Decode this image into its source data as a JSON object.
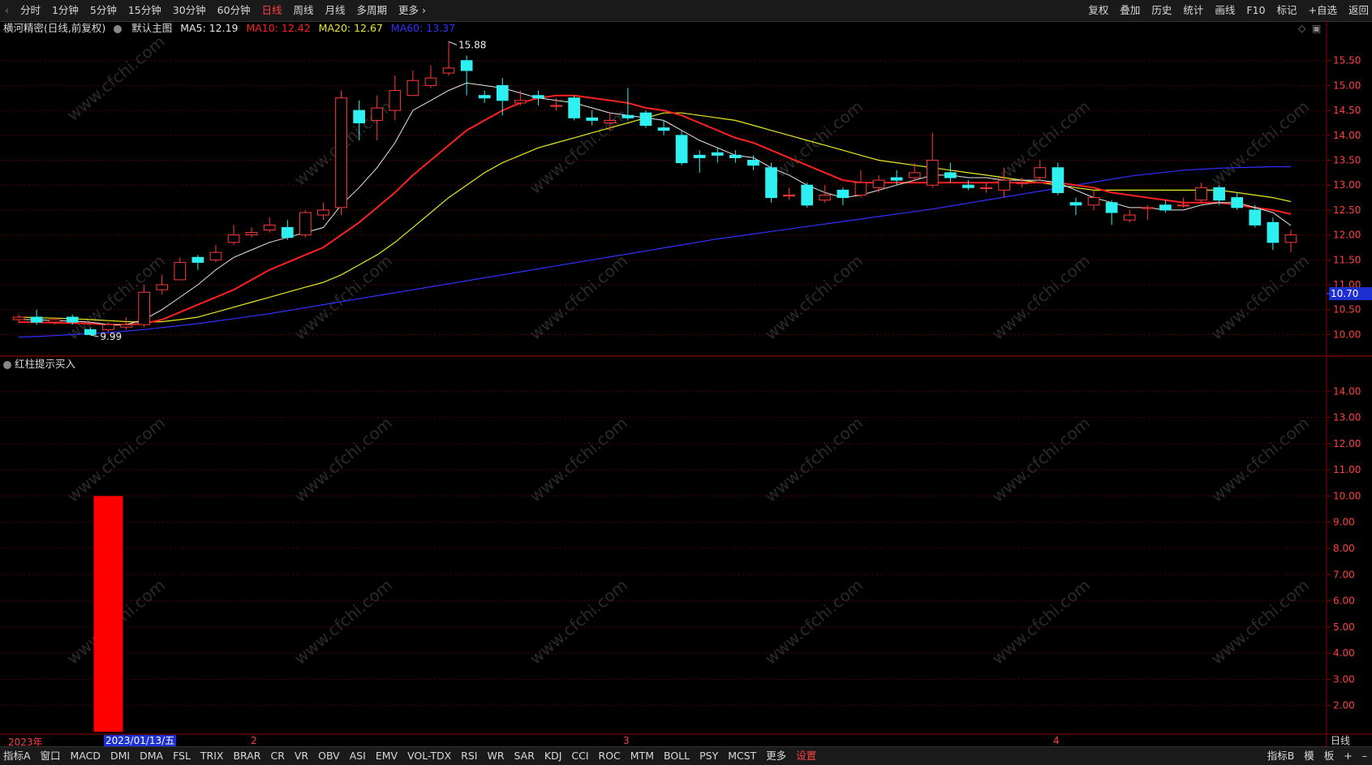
{
  "topbar": {
    "left_items": [
      "分时",
      "1分钟",
      "5分钟",
      "15分钟",
      "30分钟",
      "60分钟",
      "日线",
      "周线",
      "月线",
      "多周期",
      "更多 ›"
    ],
    "active": "日线",
    "right_items": [
      "复权",
      "叠加",
      "历史",
      "统计",
      "画线",
      "F10",
      "标记",
      "+自选",
      "返回"
    ]
  },
  "legend": {
    "stock": "横河精密(日线,前复权)",
    "template": "默认主图",
    "ma5": "MA5: 12.19",
    "ma10": "MA10: 12.42",
    "ma20": "MA20: 12.67",
    "ma60": "MA60: 13.37"
  },
  "colors": {
    "up": "#ff3b3b",
    "down": "#2ff0f0",
    "ma5": "#e8e8e8",
    "ma10": "#ff2020",
    "ma20": "#e8e820",
    "ma60": "#3030ff",
    "grid": "#5a0000",
    "axis_text": "#ff4040",
    "indicator_bar": "#ff0000"
  },
  "price_axis": [
    "15.50",
    "15.00",
    "14.50",
    "14.00",
    "13.50",
    "13.00",
    "12.50",
    "12.00",
    "11.50",
    "11.00",
    "10.50",
    "10.00"
  ],
  "current_price_tag": "10.70",
  "annotations": {
    "high": "15.88",
    "low": "9.99"
  },
  "sub_panel": {
    "title": "红柱提示买入",
    "axis": [
      "14.00",
      "13.00",
      "12.00",
      "11.00",
      "10.00",
      "9.00",
      "8.00",
      "7.00",
      "6.00",
      "5.00",
      "4.00",
      "3.00",
      "2.00"
    ],
    "signal_value": 10.0
  },
  "x_axis": {
    "labels": [
      "2023年",
      "2",
      "3",
      "4"
    ],
    "date_cursor": "2023/01/13/五",
    "period": "日线"
  },
  "botbar": {
    "left_items": [
      "指标A",
      "窗口",
      "MACD",
      "DMI",
      "DMA",
      "FSL",
      "TRIX",
      "BRAR",
      "CR",
      "VR",
      "OBV",
      "ASI",
      "EMV",
      "VOL-TDX",
      "RSI",
      "WR",
      "SAR",
      "KDJ",
      "CCI",
      "ROC",
      "MTM",
      "BOLL",
      "PSY",
      "MCST",
      "更多",
      "设置"
    ],
    "right_items": [
      "指标B",
      "模",
      "板",
      "+",
      "–"
    ]
  },
  "watermark": "www.cfchi.com",
  "chart_data": {
    "type": "candlestick",
    "candles": [
      [
        10.3,
        10.35,
        10.4,
        10.25
      ],
      [
        10.35,
        10.25,
        10.5,
        10.2
      ],
      [
        10.25,
        10.3,
        10.35,
        10.2
      ],
      [
        10.35,
        10.25,
        10.4,
        10.2
      ],
      [
        10.1,
        10.0,
        10.15,
        9.99
      ],
      [
        10.1,
        10.2,
        10.25,
        10.05
      ],
      [
        10.15,
        10.2,
        10.35,
        10.1
      ],
      [
        10.2,
        10.85,
        11.0,
        10.15
      ],
      [
        10.9,
        11.0,
        11.2,
        10.8
      ],
      [
        11.1,
        11.45,
        11.55,
        11.1
      ],
      [
        11.55,
        11.45,
        11.6,
        11.3
      ],
      [
        11.5,
        11.65,
        11.8,
        11.45
      ],
      [
        11.85,
        12.0,
        12.2,
        11.8
      ],
      [
        12.0,
        12.05,
        12.15,
        11.95
      ],
      [
        12.1,
        12.2,
        12.35,
        12.05
      ],
      [
        12.15,
        11.95,
        12.3,
        11.9
      ],
      [
        12.0,
        12.45,
        12.5,
        11.95
      ],
      [
        12.4,
        12.5,
        12.65,
        12.3
      ],
      [
        12.55,
        14.75,
        14.9,
        12.4
      ],
      [
        14.5,
        14.25,
        14.7,
        13.9
      ],
      [
        14.3,
        14.55,
        14.8,
        13.9
      ],
      [
        14.5,
        14.9,
        15.2,
        14.3
      ],
      [
        14.8,
        15.1,
        15.3,
        14.9
      ],
      [
        15.0,
        15.15,
        15.4,
        14.95
      ],
      [
        15.25,
        15.35,
        15.88,
        15.2
      ],
      [
        15.5,
        15.3,
        15.6,
        14.8
      ],
      [
        14.8,
        14.75,
        14.9,
        14.65
      ],
      [
        15.0,
        14.7,
        15.15,
        14.4
      ],
      [
        14.65,
        14.7,
        14.9,
        14.6
      ],
      [
        14.8,
        14.75,
        14.9,
        14.6
      ],
      [
        14.6,
        14.6,
        14.75,
        14.5
      ],
      [
        14.75,
        14.35,
        14.8,
        14.3
      ],
      [
        14.35,
        14.3,
        14.5,
        14.2
      ],
      [
        14.25,
        14.3,
        14.45,
        14.1
      ],
      [
        14.4,
        14.35,
        14.95,
        14.3
      ],
      [
        14.45,
        14.2,
        14.5,
        14.15
      ],
      [
        14.15,
        14.1,
        14.3,
        14.0
      ],
      [
        14.0,
        13.45,
        14.1,
        13.4
      ],
      [
        13.6,
        13.55,
        13.7,
        13.25
      ],
      [
        13.65,
        13.6,
        13.75,
        13.45
      ],
      [
        13.6,
        13.55,
        13.7,
        13.45
      ],
      [
        13.5,
        13.4,
        13.6,
        13.3
      ],
      [
        13.35,
        12.75,
        13.45,
        12.65
      ],
      [
        12.8,
        12.8,
        12.95,
        12.7
      ],
      [
        13.0,
        12.6,
        13.05,
        12.55
      ],
      [
        12.7,
        12.8,
        13.0,
        12.65
      ],
      [
        12.9,
        12.75,
        12.95,
        12.6
      ],
      [
        12.8,
        13.05,
        13.3,
        12.75
      ],
      [
        12.95,
        13.1,
        13.2,
        12.85
      ],
      [
        13.15,
        13.1,
        13.3,
        13.0
      ],
      [
        13.15,
        13.25,
        13.45,
        13.1
      ],
      [
        13.0,
        13.5,
        14.05,
        12.95
      ],
      [
        13.25,
        13.15,
        13.45,
        13.05
      ],
      [
        13.0,
        12.95,
        13.1,
        12.9
      ],
      [
        12.95,
        12.95,
        13.05,
        12.85
      ],
      [
        12.9,
        13.1,
        13.35,
        12.75
      ],
      [
        13.05,
        13.05,
        13.15,
        12.95
      ],
      [
        13.15,
        13.35,
        13.5,
        13.1
      ],
      [
        13.35,
        12.85,
        13.45,
        12.8
      ],
      [
        12.65,
        12.6,
        12.75,
        12.4
      ],
      [
        12.6,
        12.75,
        12.9,
        12.5
      ],
      [
        12.65,
        12.45,
        12.7,
        12.2
      ],
      [
        12.3,
        12.4,
        12.5,
        12.25
      ],
      [
        12.55,
        12.55,
        12.6,
        12.3
      ],
      [
        12.6,
        12.5,
        12.7,
        12.45
      ],
      [
        12.6,
        12.6,
        12.75,
        12.55
      ],
      [
        12.7,
        12.95,
        13.05,
        12.65
      ],
      [
        12.95,
        12.7,
        13.0,
        12.6
      ],
      [
        12.75,
        12.55,
        12.85,
        12.5
      ],
      [
        12.5,
        12.2,
        12.6,
        12.15
      ],
      [
        12.25,
        11.85,
        12.35,
        11.7
      ],
      [
        11.85,
        12.0,
        12.1,
        11.65
      ]
    ],
    "ma_series": {
      "MA5": [
        10.3,
        10.3,
        10.28,
        10.27,
        10.25,
        10.2,
        10.2,
        10.3,
        10.5,
        10.75,
        11.0,
        11.3,
        11.55,
        11.7,
        11.85,
        11.95,
        12.05,
        12.15,
        12.6,
        12.95,
        13.35,
        13.85,
        14.5,
        14.7,
        14.9,
        15.05,
        15.0,
        14.95,
        14.85,
        14.75,
        14.7,
        14.65,
        14.55,
        14.45,
        14.4,
        14.35,
        14.3,
        14.1,
        13.9,
        13.75,
        13.6,
        13.55,
        13.35,
        13.2,
        13.0,
        12.85,
        12.75,
        12.8,
        12.9,
        13.0,
        13.1,
        13.2,
        13.2,
        13.15,
        13.15,
        13.1,
        13.1,
        13.1,
        13.05,
        12.9,
        12.75,
        12.65,
        12.55,
        12.55,
        12.5,
        12.5,
        12.6,
        12.65,
        12.65,
        12.55,
        12.45,
        12.19
      ],
      "MA10": [
        10.25,
        10.25,
        10.24,
        10.23,
        10.22,
        10.2,
        10.2,
        10.22,
        10.3,
        10.45,
        10.6,
        10.75,
        10.9,
        11.1,
        11.3,
        11.45,
        11.6,
        11.75,
        12.0,
        12.25,
        12.55,
        12.85,
        13.2,
        13.5,
        13.8,
        14.1,
        14.3,
        14.5,
        14.65,
        14.75,
        14.8,
        14.8,
        14.75,
        14.7,
        14.65,
        14.55,
        14.5,
        14.4,
        14.25,
        14.1,
        13.95,
        13.85,
        13.7,
        13.55,
        13.4,
        13.25,
        13.1,
        13.05,
        13.05,
        13.05,
        13.05,
        13.05,
        13.05,
        13.05,
        13.05,
        13.05,
        13.05,
        13.05,
        13.05,
        13.0,
        12.95,
        12.85,
        12.8,
        12.75,
        12.7,
        12.65,
        12.65,
        12.65,
        12.6,
        12.55,
        12.5,
        12.42
      ],
      "MA20": [
        10.35,
        10.34,
        10.33,
        10.32,
        10.3,
        10.28,
        10.26,
        10.25,
        10.26,
        10.3,
        10.35,
        10.45,
        10.55,
        10.65,
        10.75,
        10.85,
        10.95,
        11.05,
        11.2,
        11.4,
        11.6,
        11.85,
        12.15,
        12.45,
        12.75,
        13.0,
        13.25,
        13.45,
        13.6,
        13.75,
        13.85,
        13.95,
        14.05,
        14.15,
        14.25,
        14.35,
        14.45,
        14.45,
        14.4,
        14.35,
        14.3,
        14.2,
        14.1,
        14.0,
        13.9,
        13.8,
        13.7,
        13.6,
        13.5,
        13.45,
        13.4,
        13.35,
        13.3,
        13.25,
        13.2,
        13.15,
        13.1,
        13.05,
        13.0,
        12.95,
        12.9,
        12.9,
        12.9,
        12.9,
        12.9,
        12.9,
        12.9,
        12.9,
        12.85,
        12.8,
        12.75,
        12.67
      ],
      "MA60": [
        9.95,
        9.96,
        9.98,
        10.0,
        10.02,
        10.04,
        10.07,
        10.1,
        10.14,
        10.18,
        10.22,
        10.27,
        10.32,
        10.37,
        10.42,
        10.48,
        10.54,
        10.6,
        10.66,
        10.72,
        10.78,
        10.84,
        10.9,
        10.96,
        11.02,
        11.08,
        11.14,
        11.2,
        11.26,
        11.32,
        11.38,
        11.44,
        11.5,
        11.56,
        11.62,
        11.68,
        11.74,
        11.8,
        11.86,
        11.92,
        11.97,
        12.02,
        12.07,
        12.12,
        12.17,
        12.22,
        12.27,
        12.32,
        12.37,
        12.42,
        12.47,
        12.52,
        12.58,
        12.64,
        12.7,
        12.76,
        12.82,
        12.88,
        12.94,
        13.0,
        13.06,
        13.12,
        13.18,
        13.22,
        13.26,
        13.3,
        13.32,
        13.34,
        13.35,
        13.36,
        13.37,
        13.37
      ]
    },
    "price_range": [
      9.6,
      16.0
    ],
    "indicator_bars": [
      {
        "index": 5,
        "value": 10.0
      }
    ],
    "indicator_range": [
      1.0,
      15.0
    ]
  }
}
